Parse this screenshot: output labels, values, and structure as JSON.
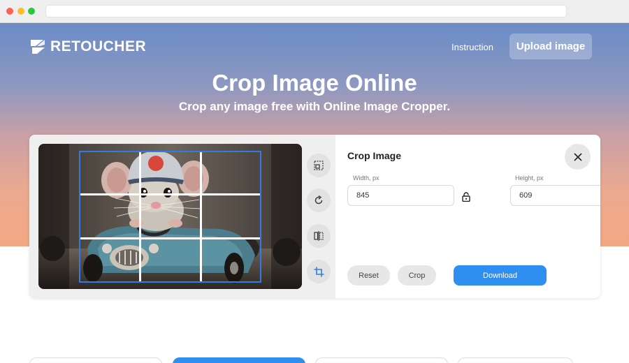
{
  "brand": {
    "name": "RETOUCHER",
    "accent": "#2f8ff0"
  },
  "nav": {
    "instruction": "Instruction",
    "upload": "Upload image"
  },
  "hero": {
    "title": "Crop Image Online",
    "subtitle": "Crop any image free with Online Image Cropper."
  },
  "editor": {
    "image": "photo of a mouse wearing a helmet driving a toy race car",
    "tools": [
      "aspect-ratio-icon",
      "rotate-icon",
      "flip-icon",
      "crop-icon"
    ],
    "panel": {
      "title": "Crop Image",
      "width_label": "Width, px",
      "width_value": "845",
      "height_label": "Height, px",
      "height_value": "609",
      "reset": "Reset",
      "crop": "Crop",
      "download": "Download"
    }
  }
}
